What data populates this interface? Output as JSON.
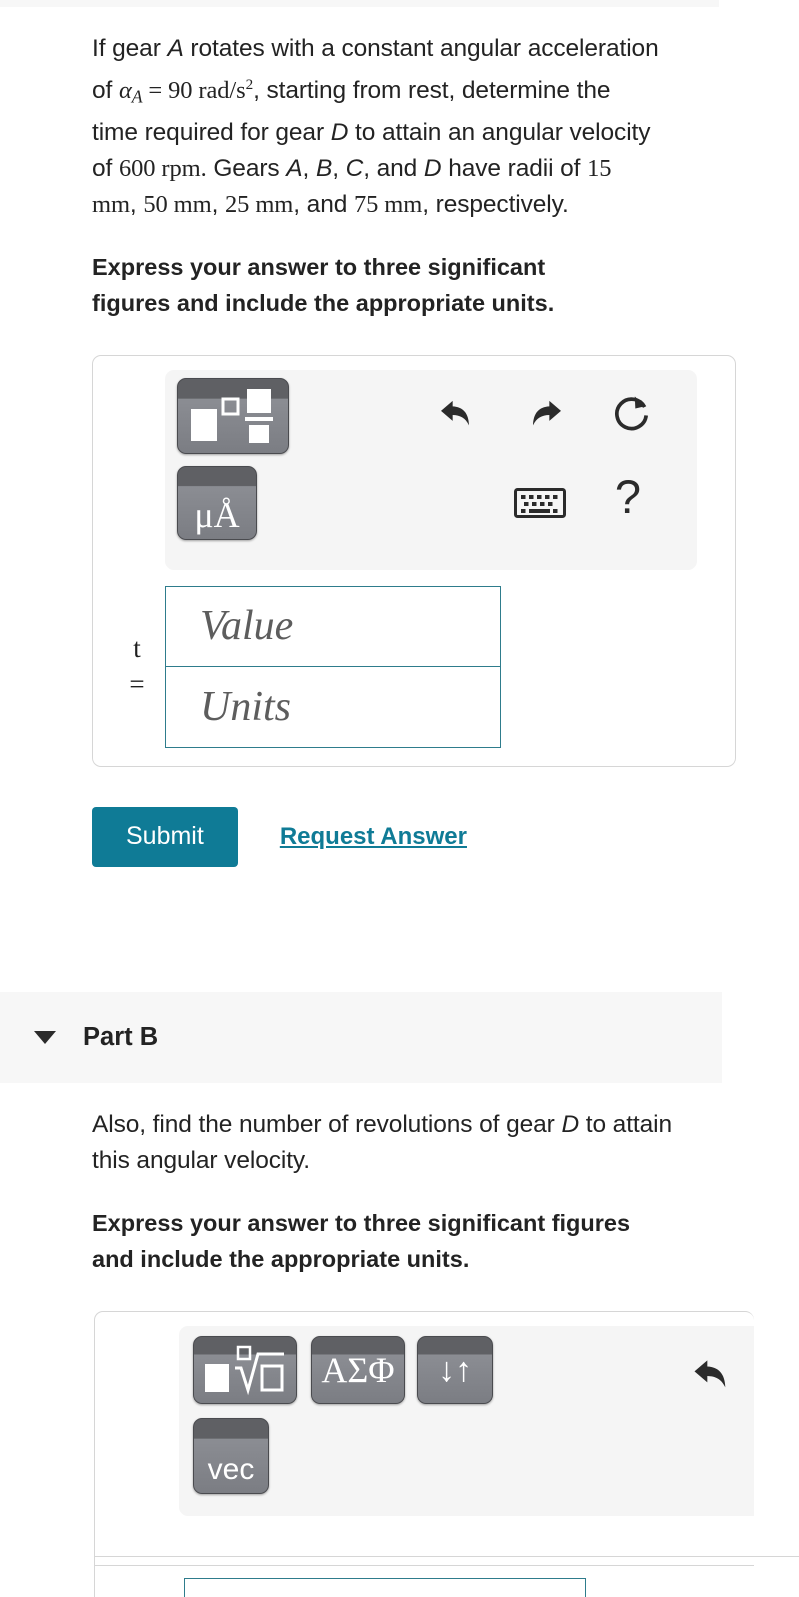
{
  "part_a": {
    "problem_lines": [
      "If gear A rotates with a constant angular",
      "acceleration of αA = 90 rad/s² , starting",
      "from rest, determine the time required for gear",
      "D to attain an angular velocity of 600 rpm.",
      "Gears A, B, C, and D have radii of 15 mm, 50",
      "mm, 25 mm, and 75 mm, respectively."
    ],
    "problem_tokens": {
      "t1": "If gear ",
      "gear_a": "A",
      "t2": " rotates with a constant angular acceleration of ",
      "alpha": "α",
      "alpha_sub": "A",
      "equals": "=",
      "accel_value": "90 rad",
      "slash": "/",
      "accel_unit": "s",
      "accel_exp": "2",
      "t3": ", starting from rest, determine the time required for gear ",
      "gear_d": "D",
      "t4": " to attain an angular velocity of ",
      "omega_value": "600 rpm.",
      "t5": "Gears ",
      "ga": "A",
      "gb": "B",
      "gc": "C",
      "gd": "D",
      "t6": ", ",
      "t7": ", ",
      "t8": ", and ",
      "t9": " have radii of ",
      "r1": "15 mm",
      "r2": "50 mm",
      "r3": "25 mm",
      "r4": "75 mm",
      "t10": ", ",
      "t11": ", ",
      "t12": ", and ",
      "t13": ", respectively."
    },
    "instruction": "Express your answer to three significant figures and include the appropriate units.",
    "toolbar": {
      "template_button_label": "template-math-palette",
      "units_button_label": "μÅ",
      "units_button_mu": "μ",
      "units_button_a": "A",
      "units_button_ring": "˚",
      "undo_label": "undo",
      "redo_label": "redo",
      "reset_label": "reset",
      "keyboard_label": "keyboard",
      "help_label": "?"
    },
    "answer": {
      "var_label": "t",
      "equals_label": "=",
      "value_placeholder": "Value",
      "units_placeholder": "Units",
      "value_current": "",
      "units_current": ""
    },
    "submit_label": "Submit",
    "request_answer_label": "Request Answer"
  },
  "part_b": {
    "header_title": "Part B",
    "collapsed": false,
    "problem_text": "Also, find the number of revolutions of gear D to attain this angular velocity.",
    "problem_tokens": {
      "t1": "Also, find the number of revolutions of gear ",
      "gear_d": "D",
      "t2": " to attain this angular velocity."
    },
    "instruction": "Express your answer to three significant figures and include the appropriate units.",
    "toolbar": {
      "template_button_label": "radical-math-palette",
      "greek_button_label": "ΑΣΦ",
      "updown_button_label": "↓↑",
      "vec_button_label": "vec",
      "undo_label": "undo"
    }
  },
  "colors": {
    "accent_teal": "#0f7b96",
    "field_border": "#2e7c8c",
    "panel_border": "#d6d6d6",
    "toolbar_bg": "#f5f5f5",
    "section_header_bg": "#f7f7f7",
    "text": "#232323"
  }
}
